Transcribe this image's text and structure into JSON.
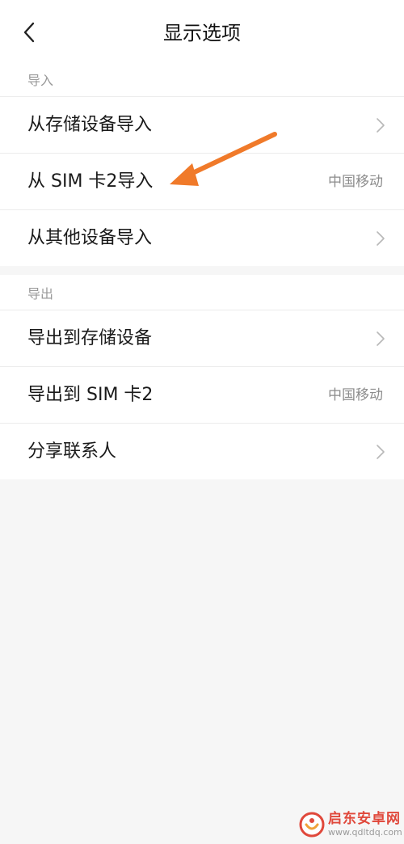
{
  "header": {
    "title": "显示选项",
    "back_icon": "chevron-left-icon"
  },
  "sections": [
    {
      "header": "导入",
      "items": [
        {
          "label": "从存储设备导入",
          "value": "",
          "trailing": "chevron-right-icon"
        },
        {
          "label": "从 SIM 卡2导入",
          "value": "中国移动",
          "trailing": ""
        },
        {
          "label": "从其他设备导入",
          "value": "",
          "trailing": "chevron-right-icon"
        }
      ]
    },
    {
      "header": "导出",
      "items": [
        {
          "label": "导出到存储设备",
          "value": "",
          "trailing": "chevron-right-icon"
        },
        {
          "label": "导出到 SIM 卡2",
          "value": "中国移动",
          "trailing": ""
        },
        {
          "label": "分享联系人",
          "value": "",
          "trailing": "chevron-right-icon"
        }
      ]
    }
  ],
  "annotation": {
    "arrow_icon": "arrow-annotation-icon",
    "color": "#f07a2a"
  },
  "watermark": {
    "title": "启东安卓网",
    "url": "www.qdltdq.com"
  },
  "colors": {
    "background": "#f6f6f6",
    "surface": "#ffffff",
    "text_primary": "#1a1a1a",
    "text_secondary": "#8c8c8c"
  }
}
